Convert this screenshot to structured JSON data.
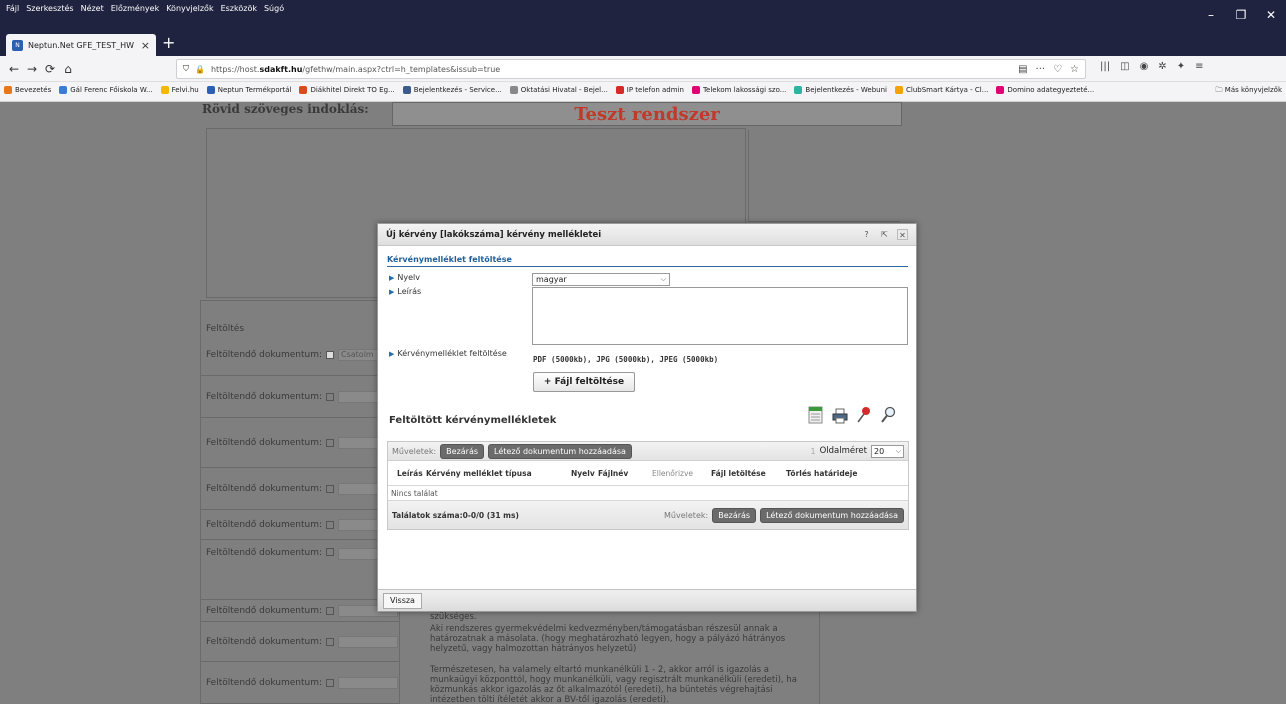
{
  "browser": {
    "menus": [
      "Fájl",
      "Szerkesztés",
      "Nézet",
      "Előzmények",
      "Könyvjelzők",
      "Eszközök",
      "Súgó"
    ],
    "window_controls": {
      "minimize": "–",
      "restore": "❐",
      "close": "✕"
    },
    "tab_title": "Neptun.Net GFE_TEST_HW",
    "url_prefix": "https://host.",
    "url_domain": "sdakft.hu",
    "url_suffix": "/gfethw/main.aspx?ctrl=h_templates&issub=true",
    "bookmarks": [
      {
        "label": "Bevezetés",
        "color": "#e8761a"
      },
      {
        "label": "Gál Ferenc Főiskola W...",
        "color": "#3a7bd5"
      },
      {
        "label": "Felvi.hu",
        "color": "#f5b800"
      },
      {
        "label": "Neptun Termékportál",
        "color": "#2a5fb2"
      },
      {
        "label": "Diákhitel Direkt TO Eg...",
        "color": "#d94a1c"
      },
      {
        "label": "Bejelentkezés - Service...",
        "color": "#3d5a8a"
      },
      {
        "label": "Oktatási Hivatal - Bejel...",
        "color": "#888888"
      },
      {
        "label": "IP telefon admin",
        "color": "#d62a2a"
      },
      {
        "label": "Telekom lakossági szo...",
        "color": "#e20074"
      },
      {
        "label": "Bejelentkezés - Webuni",
        "color": "#2bb5a0"
      },
      {
        "label": "ClubSmart Kártya - Cl...",
        "color": "#f4a300"
      },
      {
        "label": "Domino adategyezteté...",
        "color": "#e20074"
      }
    ],
    "other_bookmarks": "Más könyvjelzők"
  },
  "page": {
    "title": "Rövid szöveges indoklás:",
    "test_banner": "Teszt rendszer",
    "upload_section": "Feltöltés",
    "doc_label": "Feltöltendő dokumentum:",
    "attach_button": "Csatolm",
    "desc1": "szükséges.",
    "desc2": "Aki rendszeres gyermekvédelmi kedvezményben/támogatásban részesül annak a határozatnak a másolata. (hogy meghatározható legyen, hogy a pályázó hátrányos helyzetű, vagy halmozottan hátrányos helyzetű)",
    "desc3": "Természetesen, ha valamely eltartó munkanélküli 1 - 2, akkor arról is igazolás a munkaügyi központtól, hogy munkanélküli, vagy regisztrált munkanélküli (eredeti), ha közmunkás akkor igazolás az őt alkalmazótól (eredeti), ha büntetés végrehajtási intézetben tölti ítéletét akkor a BV-től igazolás (eredeti)."
  },
  "modal": {
    "title": "Új kérvény [lakókszáma] kérvény mellékletei",
    "help": "?",
    "close": "✕",
    "section_title": "Kérvénymelléklet feltöltése",
    "language_label": "Nyelv",
    "language_value": "magyar",
    "description_label": "Leírás",
    "upload_label": "Kérvénymelléklet feltöltése",
    "file_types": "PDF (5000kb), JPG (5000kb), JPEG (5000kb)",
    "upload_button": "+ Fájl feltöltése",
    "uploaded_title": "Feltöltött kérvénymellékletek",
    "actions_label": "Műveletek:",
    "close_button": "Bezárás",
    "add_existing_button": "Létező dokumentum hozzáadása",
    "page_number": "1",
    "page_size_label": "Oldalméret",
    "page_size_value": "20",
    "columns": [
      "Leírás",
      "Kérvény melléklet típusa",
      "Nyelv",
      "Fájlnév",
      "Ellenőrizve",
      "Fájl letöltése",
      "Törlés határideje"
    ],
    "empty_text": "Nincs találat",
    "results_count": "Találatok száma:0-0/0 (31 ms)",
    "back_button": "Vissza"
  }
}
